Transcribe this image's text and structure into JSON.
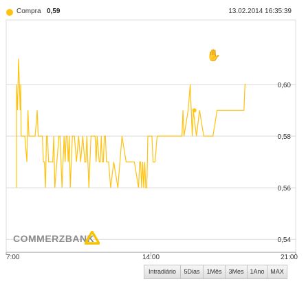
{
  "header": {
    "legend_label": "Compra",
    "legend_value": "0,59",
    "timestamp": "13.02.2014 16:35:39"
  },
  "colors": {
    "series": "#ffc20e",
    "grid": "#d9d9d9",
    "axis": "#999999",
    "brand_logo": "#8c8c8c",
    "brand_mark": "#f5c400"
  },
  "brand": {
    "name": "COMMERZBANK"
  },
  "range_tabs": [
    "Intradiário",
    "5Dias",
    "1Mês",
    "3Mes",
    "1Ano",
    "MAX"
  ],
  "icons": {
    "cursor": "hand-grab-icon",
    "legend": "legend-dot-icon",
    "brand": "commerzbank-ribbon-icon"
  },
  "chart_data": {
    "type": "line",
    "xlabel": "",
    "ylabel": "",
    "x_ticks": [
      "7:00",
      "14:00",
      "21:00"
    ],
    "x_tick_hours": [
      7,
      14,
      21
    ],
    "xlim_hours": [
      7,
      21
    ],
    "y_ticks": [
      "0,54",
      "0,56",
      "0,58",
      "0,60"
    ],
    "ylim": [
      0.535,
      0.625
    ],
    "grid": true,
    "y_axis_side": "right",
    "series": [
      {
        "name": "Compra",
        "x_hours": [
          7.5,
          7.5,
          7.55,
          7.6,
          7.68,
          7.7,
          7.72,
          7.75,
          7.8,
          7.9,
          8.0,
          8.05,
          8.1,
          8.2,
          8.3,
          8.4,
          8.5,
          8.55,
          8.6,
          8.65,
          8.75,
          8.8,
          8.85,
          8.9,
          8.95,
          9.0,
          9.05,
          9.1,
          9.15,
          9.2,
          9.25,
          9.3,
          9.35,
          9.45,
          9.55,
          9.6,
          9.7,
          9.8,
          9.85,
          9.9,
          9.95,
          10.0,
          10.05,
          10.1,
          10.2,
          10.3,
          10.4,
          10.5,
          10.6,
          10.7,
          10.8,
          10.85,
          10.9,
          11.0,
          11.1,
          11.2,
          11.3,
          11.35,
          11.4,
          11.5,
          11.55,
          11.6,
          11.65,
          11.7,
          11.75,
          11.8,
          11.85,
          11.95,
          12.05,
          12.2,
          12.4,
          12.6,
          12.8,
          13.0,
          13.2,
          13.4,
          13.45,
          13.5,
          13.55,
          13.6,
          13.65,
          13.7,
          13.75,
          13.8,
          13.85,
          13.9,
          14.0,
          14.05,
          14.1,
          14.15,
          14.2,
          14.3,
          14.5,
          14.7,
          15.0,
          15.2,
          15.5,
          15.55,
          15.6,
          15.8,
          15.9,
          16.0,
          16.05,
          16.2,
          16.35,
          16.55,
          16.8,
          17.0,
          17.2,
          17.5,
          17.6,
          17.75,
          17.75,
          17.8,
          18.0,
          18.3,
          18.5,
          18.5,
          18.55,
          18.6
        ],
        "values": [
          0.56,
          0.6,
          0.59,
          0.61,
          0.59,
          0.6,
          0.58,
          0.58,
          0.58,
          0.58,
          0.57,
          0.59,
          0.58,
          0.58,
          0.58,
          0.58,
          0.59,
          0.58,
          0.58,
          0.58,
          0.58,
          0.57,
          0.57,
          0.56,
          0.58,
          0.58,
          0.57,
          0.57,
          0.57,
          0.57,
          0.57,
          0.58,
          0.56,
          0.57,
          0.58,
          0.58,
          0.56,
          0.58,
          0.57,
          0.58,
          0.58,
          0.57,
          0.58,
          0.56,
          0.58,
          0.58,
          0.57,
          0.58,
          0.57,
          0.58,
          0.57,
          0.57,
          0.58,
          0.56,
          0.58,
          0.58,
          0.58,
          0.57,
          0.58,
          0.57,
          0.57,
          0.58,
          0.57,
          0.57,
          0.58,
          0.58,
          0.57,
          0.57,
          0.56,
          0.57,
          0.56,
          0.58,
          0.57,
          0.57,
          0.57,
          0.56,
          0.57,
          0.57,
          0.56,
          0.57,
          0.56,
          0.57,
          0.56,
          0.56,
          0.58,
          0.58,
          0.58,
          0.58,
          0.57,
          0.57,
          0.57,
          0.58,
          0.58,
          0.58,
          0.58,
          0.58,
          0.58,
          0.59,
          0.58,
          0.59,
          0.6,
          0.58,
          0.59,
          0.58,
          0.59,
          0.58,
          0.58,
          0.58,
          0.59,
          0.59,
          0.59,
          0.59,
          0.59,
          0.59,
          0.59,
          0.59,
          0.59,
          0.59,
          0.6,
          0.6
        ],
        "marker": {
          "x_hours": 16.1,
          "value": 0.59
        }
      }
    ]
  }
}
